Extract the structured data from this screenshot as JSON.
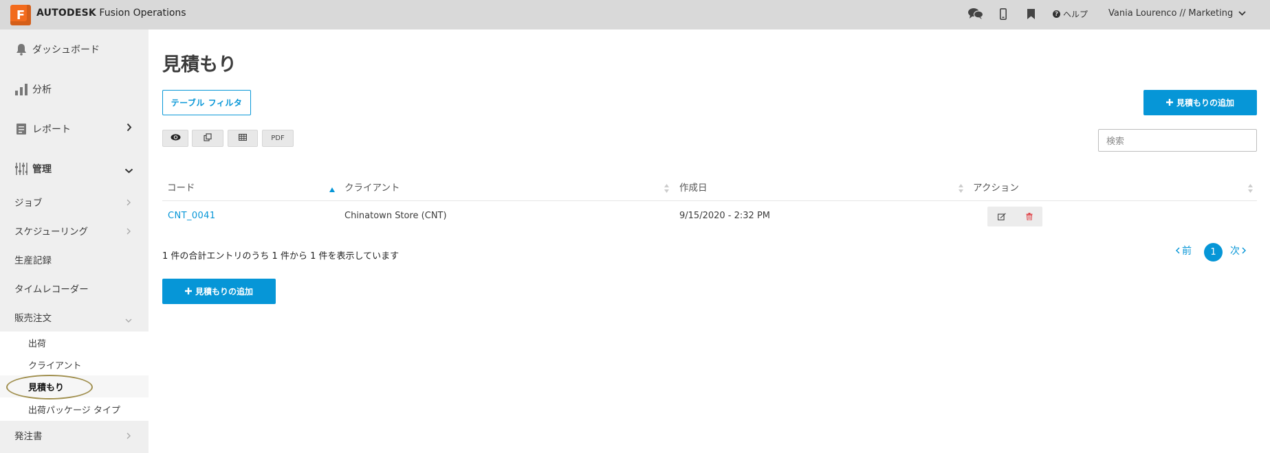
{
  "app": {
    "logo_letter": "F",
    "brand_bold": "AUTODESK",
    "brand_rest": " Fusion Operations",
    "help_label": "ヘルプ",
    "user_label": "Vania Lourenco // Marketing"
  },
  "sidebar": {
    "dashboard": "ダッシュボード",
    "analytics": "分析",
    "reports": "レポート",
    "manage": "管理",
    "jobs": "ジョブ",
    "scheduling": "スケジューリング",
    "production_log": "生産記録",
    "time_recorder": "タイムレコーダー",
    "sales_orders": "販売注文",
    "sales_sub": [
      "出荷",
      "クライアント",
      "見積もり",
      "出荷パッケージ タイプ"
    ],
    "purchase_orders": "発注書"
  },
  "page": {
    "title": "見積もり",
    "table_filter": "テーブル フィルタ",
    "add_quote": "見積もりの追加",
    "pdf": "PDF",
    "search_placeholder": "検索",
    "info": "1 件の合計エントリのうち 1 件から 1 件を表示しています",
    "prev": "前",
    "next": "次",
    "page_number": "1"
  },
  "table": {
    "columns": [
      "コード",
      "クライアント",
      "作成日",
      "アクション"
    ],
    "rows": [
      {
        "code": "CNT_0041",
        "client": "Chinatown Store (CNT)",
        "created": "9/15/2020 - 2:32 PM"
      }
    ]
  },
  "colors": {
    "accent": "#0696d7",
    "logo": "#f26b1d",
    "delete": "#e0474c",
    "highlight_ring": "#a08f4e"
  },
  "icons": {
    "chat": "chat-icon",
    "mobile": "mobile-icon",
    "bookmark": "bookmark-icon",
    "help": "help-circle-icon",
    "bell": "bell-icon",
    "bars": "bar-chart-icon",
    "report": "report-icon",
    "sliders": "sliders-icon",
    "eye": "eye-icon",
    "copy": "copy-icon",
    "table": "table-icon",
    "edit": "edit-icon",
    "trash": "trash-icon"
  }
}
